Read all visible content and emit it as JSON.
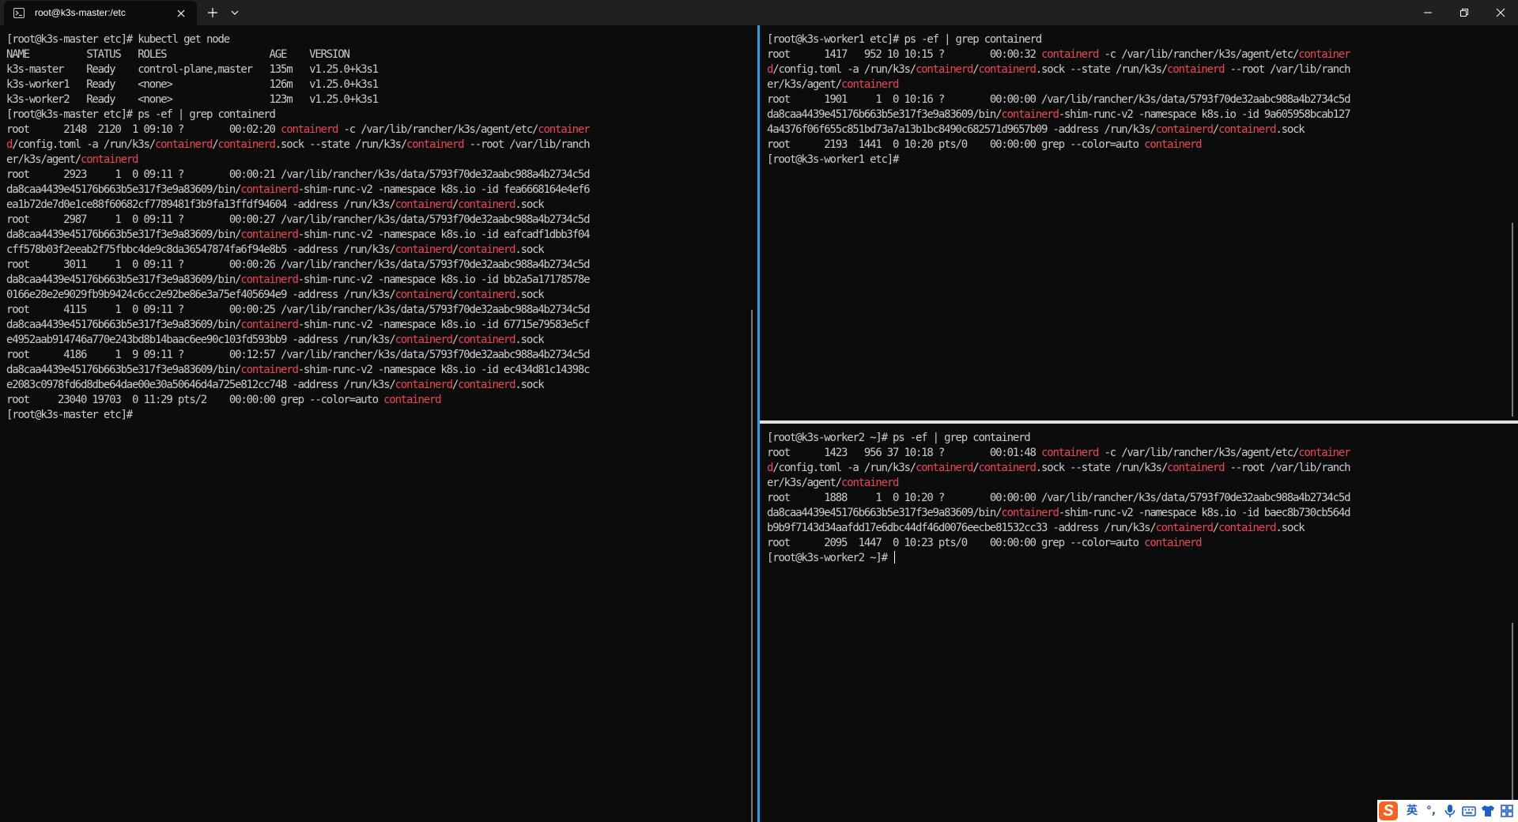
{
  "window": {
    "tab_title": "root@k3s-master:/etc",
    "icons": {
      "tab": "terminal-icon",
      "close_tab": "close-icon",
      "new_tab": "plus-icon",
      "dropdown": "chevron-down-icon",
      "minimize": "minimize-icon",
      "restore": "restore-icon",
      "close": "close-icon"
    }
  },
  "colors": {
    "background": "#0c0c0c",
    "text": "#cccccc",
    "highlight": "#e74856",
    "active_pane_border": "#3a96dd"
  },
  "panes": {
    "master": {
      "host": "k3s-master",
      "lines": [
        [
          "[root@k3s-master etc]# kubectl get node"
        ],
        [
          "NAME          STATUS   ROLES                  AGE    VERSION"
        ],
        [
          "k3s-master    Ready    control-plane,master   135m   v1.25.0+k3s1"
        ],
        [
          "k3s-worker1   Ready    <none>                 126m   v1.25.0+k3s1"
        ],
        [
          "k3s-worker2   Ready    <none>                 123m   v1.25.0+k3s1"
        ],
        [
          "[root@k3s-master etc]# ps -ef | grep containerd"
        ],
        [
          "root      2148  2120  1 09:10 ?        00:02:20 ",
          {
            "h": "containerd"
          },
          " -c /var/lib/rancher/k3s/agent/etc/",
          {
            "h": "container"
          }
        ],
        [
          {
            "h": "d"
          },
          "/config.toml -a /run/k3s/",
          {
            "h": "containerd"
          },
          "/",
          {
            "h": "containerd"
          },
          ".sock --state /run/k3s/",
          {
            "h": "containerd"
          },
          " --root /var/lib/ranch"
        ],
        [
          "er/k3s/agent/",
          {
            "h": "containerd"
          }
        ],
        [
          "root      2923     1  0 09:11 ?        00:00:21 /var/lib/rancher/k3s/data/5793f70de32aabc988a4b2734c5d"
        ],
        [
          "da8caa4439e45176b663b5e317f3e9a83609/bin/",
          {
            "h": "containerd"
          },
          "-shim-runc-v2 -namespace k8s.io -id fea6668164e4ef6"
        ],
        [
          "ea1b72de7d0e1ce88f60682cf7789481f3b9fa13ffdf94604 -address /run/k3s/",
          {
            "h": "containerd"
          },
          "/",
          {
            "h": "containerd"
          },
          ".sock"
        ],
        [
          "root      2987     1  0 09:11 ?        00:00:27 /var/lib/rancher/k3s/data/5793f70de32aabc988a4b2734c5d"
        ],
        [
          "da8caa4439e45176b663b5e317f3e9a83609/bin/",
          {
            "h": "containerd"
          },
          "-shim-runc-v2 -namespace k8s.io -id eafcadf1dbb3f04"
        ],
        [
          "cff578b03f2eeab2f75fbbc4de9c8da36547874fa6f94e8b5 -address /run/k3s/",
          {
            "h": "containerd"
          },
          "/",
          {
            "h": "containerd"
          },
          ".sock"
        ],
        [
          "root      3011     1  0 09:11 ?        00:00:26 /var/lib/rancher/k3s/data/5793f70de32aabc988a4b2734c5d"
        ],
        [
          "da8caa4439e45176b663b5e317f3e9a83609/bin/",
          {
            "h": "containerd"
          },
          "-shim-runc-v2 -namespace k8s.io -id bb2a5a17178578e"
        ],
        [
          "0166e28e2e9029fb9b9424c6cc2e92be86e3a75ef405694e9 -address /run/k3s/",
          {
            "h": "containerd"
          },
          "/",
          {
            "h": "containerd"
          },
          ".sock"
        ],
        [
          "root      4115     1  0 09:11 ?        00:00:25 /var/lib/rancher/k3s/data/5793f70de32aabc988a4b2734c5d"
        ],
        [
          "da8caa4439e45176b663b5e317f3e9a83609/bin/",
          {
            "h": "containerd"
          },
          "-shim-runc-v2 -namespace k8s.io -id 67715e79583e5cf"
        ],
        [
          "e4952aab914746a770e243bd8b14baac6ee90c103fd593bb9 -address /run/k3s/",
          {
            "h": "containerd"
          },
          "/",
          {
            "h": "containerd"
          },
          ".sock"
        ],
        [
          "root      4186     1  9 09:11 ?        00:12:57 /var/lib/rancher/k3s/data/5793f70de32aabc988a4b2734c5d"
        ],
        [
          "da8caa4439e45176b663b5e317f3e9a83609/bin/",
          {
            "h": "containerd"
          },
          "-shim-runc-v2 -namespace k8s.io -id ec434d81c14398c"
        ],
        [
          "e2083c0978fd6d8dbe64dae00e30a50646d4a725e812cc748 -address /run/k3s/",
          {
            "h": "containerd"
          },
          "/",
          {
            "h": "containerd"
          },
          ".sock"
        ],
        [
          "root     23040 19703  0 11:29 pts/2    00:00:00 grep --color=auto ",
          {
            "h": "containerd"
          }
        ],
        [
          "[root@k3s-master etc]#"
        ]
      ]
    },
    "worker1": {
      "host": "k3s-worker1",
      "lines": [
        [
          "[root@k3s-worker1 etc]# ps -ef | grep containerd"
        ],
        [
          "root      1417   952 10 10:15 ?        00:00:32 ",
          {
            "h": "containerd"
          },
          " -c /var/lib/rancher/k3s/agent/etc/",
          {
            "h": "container"
          }
        ],
        [
          {
            "h": "d"
          },
          "/config.toml -a /run/k3s/",
          {
            "h": "containerd"
          },
          "/",
          {
            "h": "containerd"
          },
          ".sock --state /run/k3s/",
          {
            "h": "containerd"
          },
          " --root /var/lib/ranch"
        ],
        [
          "er/k3s/agent/",
          {
            "h": "containerd"
          }
        ],
        [
          "root      1901     1  0 10:16 ?        00:00:00 /var/lib/rancher/k3s/data/5793f70de32aabc988a4b2734c5d"
        ],
        [
          "da8caa4439e45176b663b5e317f3e9a83609/bin/",
          {
            "h": "containerd"
          },
          "-shim-runc-v2 -namespace k8s.io -id 9a605958bcab127"
        ],
        [
          "4a4376f06f655c851bd73a7a13b1bc8490c682571d9657b09 -address /run/k3s/",
          {
            "h": "containerd"
          },
          "/",
          {
            "h": "containerd"
          },
          ".sock"
        ],
        [
          "root      2193  1441  0 10:20 pts/0    00:00:00 grep --color=auto ",
          {
            "h": "containerd"
          }
        ],
        [
          "[root@k3s-worker1 etc]#"
        ]
      ]
    },
    "worker2": {
      "host": "k3s-worker2",
      "lines": [
        [
          "[root@k3s-worker2 ~]# ps -ef | grep containerd"
        ],
        [
          "root      1423   956 37 10:18 ?        00:01:48 ",
          {
            "h": "containerd"
          },
          " -c /var/lib/rancher/k3s/agent/etc/",
          {
            "h": "container"
          }
        ],
        [
          {
            "h": "d"
          },
          "/config.toml -a /run/k3s/",
          {
            "h": "containerd"
          },
          "/",
          {
            "h": "containerd"
          },
          ".sock --state /run/k3s/",
          {
            "h": "containerd"
          },
          " --root /var/lib/ranch"
        ],
        [
          "er/k3s/agent/",
          {
            "h": "containerd"
          }
        ],
        [
          "root      1888     1  0 10:20 ?        00:00:00 /var/lib/rancher/k3s/data/5793f70de32aabc988a4b2734c5d"
        ],
        [
          "da8caa4439e45176b663b5e317f3e9a83609/bin/",
          {
            "h": "containerd"
          },
          "-shim-runc-v2 -namespace k8s.io -id baec8b730cb564d"
        ],
        [
          "b9b9f7143d34aafdd17e6dbc44df46d0076eecbe81532cc33 -address /run/k3s/",
          {
            "h": "containerd"
          },
          "/",
          {
            "h": "containerd"
          },
          ".sock"
        ],
        [
          "root      2095  1447  0 10:23 pts/0    00:00:00 grep --color=auto ",
          {
            "h": "containerd"
          }
        ],
        [
          "[root@k3s-worker2 ~]# "
        ]
      ]
    }
  },
  "ime_toolbar": {
    "logo": "S",
    "language": "英",
    "punctuation": "°,",
    "icons": [
      "sogou-logo-icon",
      "microphone-icon",
      "keyboard-icon",
      "skin-icon",
      "grid-icon"
    ]
  }
}
